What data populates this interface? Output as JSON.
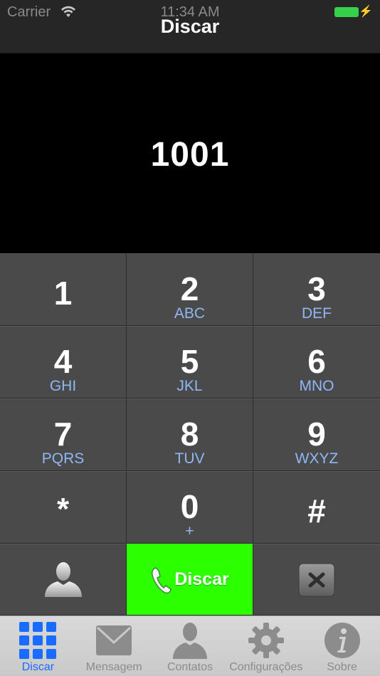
{
  "status_bar": {
    "carrier": "Carrier",
    "time": "11:34 AM"
  },
  "nav": {
    "title": "Discar"
  },
  "display": {
    "number": "1001"
  },
  "keypad": {
    "keys": [
      {
        "digit": "1",
        "letters": ""
      },
      {
        "digit": "2",
        "letters": "ABC"
      },
      {
        "digit": "3",
        "letters": "DEF"
      },
      {
        "digit": "4",
        "letters": "GHI"
      },
      {
        "digit": "5",
        "letters": "JKL"
      },
      {
        "digit": "6",
        "letters": "MNO"
      },
      {
        "digit": "7",
        "letters": "PQRS"
      },
      {
        "digit": "8",
        "letters": "TUV"
      },
      {
        "digit": "9",
        "letters": "WXYZ"
      },
      {
        "digit": "*",
        "letters": ""
      },
      {
        "digit": "0",
        "letters": "+"
      },
      {
        "digit": "#",
        "letters": ""
      }
    ],
    "call_label": "Discar",
    "call_color": "#2bff00"
  },
  "tab_bar": {
    "tabs": [
      {
        "label": "Discar",
        "icon": "keypad-grid-icon",
        "active": true
      },
      {
        "label": "Mensagem",
        "icon": "envelope-icon",
        "active": false
      },
      {
        "label": "Contatos",
        "icon": "person-icon",
        "active": false
      },
      {
        "label": "Configurações",
        "icon": "gear-icon",
        "active": false
      },
      {
        "label": "Sobre",
        "icon": "info-icon",
        "active": false
      }
    ],
    "active_color": "#1a6bff",
    "inactive_color": "#8c8c8c"
  }
}
